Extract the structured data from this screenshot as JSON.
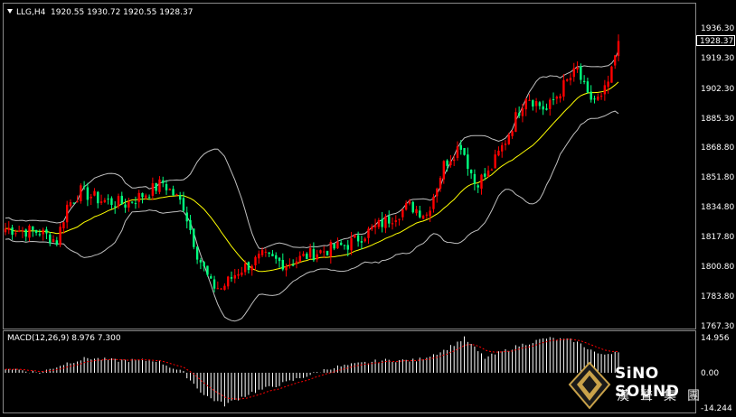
{
  "header": {
    "symbol": "LLG,H4",
    "ohlc": "1920.55 1930.72 1920.55 1928.37"
  },
  "price_axis": {
    "ticks": [
      "1936.30",
      "1919.30",
      "1902.30",
      "1885.30",
      "1868.80",
      "1851.80",
      "1834.80",
      "1817.80",
      "1800.80",
      "1783.80",
      "1767.30"
    ],
    "current_price_label": "1928.37"
  },
  "macd_panel": {
    "label": "MACD(12,26,9) 8.976 7.300",
    "ticks": [
      "14.956",
      "0.00",
      "-14.244"
    ]
  },
  "watermark": {
    "title": "SiNO SOUND",
    "subtitle": "漢聲集團"
  },
  "colors": {
    "background": "#000000",
    "bull": "#ff0000",
    "bear": "#00ff7f",
    "ma": "#ffff00",
    "bands": "#c0c0c0",
    "macd_hist": "#ffffff",
    "macd_signal": "#ff0000"
  },
  "chart_data": {
    "type": "candlestick",
    "title": "LLG,H4",
    "ylim": [
      1767.3,
      1936.3
    ],
    "overlays": [
      "moving average",
      "bollinger bands"
    ],
    "close_points": [
      {
        "bar": 0,
        "close": 1822
      },
      {
        "bar": 10,
        "close": 1820
      },
      {
        "bar": 15,
        "close": 1815
      },
      {
        "bar": 18,
        "close": 1835
      },
      {
        "bar": 22,
        "close": 1843
      },
      {
        "bar": 28,
        "close": 1838
      },
      {
        "bar": 35,
        "close": 1836
      },
      {
        "bar": 42,
        "close": 1843
      },
      {
        "bar": 46,
        "close": 1848
      },
      {
        "bar": 52,
        "close": 1835
      },
      {
        "bar": 56,
        "close": 1808
      },
      {
        "bar": 60,
        "close": 1790
      },
      {
        "bar": 63,
        "close": 1788
      },
      {
        "bar": 68,
        "close": 1798
      },
      {
        "bar": 75,
        "close": 1806
      },
      {
        "bar": 82,
        "close": 1802
      },
      {
        "bar": 90,
        "close": 1808
      },
      {
        "bar": 100,
        "close": 1813
      },
      {
        "bar": 110,
        "close": 1825
      },
      {
        "bar": 118,
        "close": 1835
      },
      {
        "bar": 123,
        "close": 1830
      },
      {
        "bar": 128,
        "close": 1858
      },
      {
        "bar": 133,
        "close": 1870
      },
      {
        "bar": 137,
        "close": 1848
      },
      {
        "bar": 141,
        "close": 1853
      },
      {
        "bar": 146,
        "close": 1872
      },
      {
        "bar": 152,
        "close": 1898
      },
      {
        "bar": 158,
        "close": 1889
      },
      {
        "bar": 163,
        "close": 1903
      },
      {
        "bar": 167,
        "close": 1912
      },
      {
        "bar": 170,
        "close": 1896
      },
      {
        "bar": 174,
        "close": 1895
      },
      {
        "bar": 177,
        "close": 1910
      },
      {
        "bar": 179,
        "close": 1928.37
      }
    ],
    "macd": {
      "label": "MACD(12,26,9)",
      "value": 8.976,
      "signal_value": 7.3,
      "ylim": [
        -14.244,
        14.956
      ],
      "histogram_points": [
        {
          "bar": 0,
          "value": 2
        },
        {
          "bar": 10,
          "value": 0
        },
        {
          "bar": 18,
          "value": 4
        },
        {
          "bar": 24,
          "value": 6
        },
        {
          "bar": 32,
          "value": 5
        },
        {
          "bar": 44,
          "value": 5
        },
        {
          "bar": 52,
          "value": 0
        },
        {
          "bar": 58,
          "value": -9
        },
        {
          "bar": 64,
          "value": -13
        },
        {
          "bar": 72,
          "value": -8
        },
        {
          "bar": 82,
          "value": -4
        },
        {
          "bar": 95,
          "value": 2
        },
        {
          "bar": 110,
          "value": 5
        },
        {
          "bar": 120,
          "value": 5
        },
        {
          "bar": 128,
          "value": 9
        },
        {
          "bar": 134,
          "value": 14
        },
        {
          "bar": 140,
          "value": 6
        },
        {
          "bar": 150,
          "value": 11
        },
        {
          "bar": 158,
          "value": 14
        },
        {
          "bar": 166,
          "value": 13
        },
        {
          "bar": 174,
          "value": 7
        },
        {
          "bar": 179,
          "value": 9
        }
      ]
    }
  }
}
